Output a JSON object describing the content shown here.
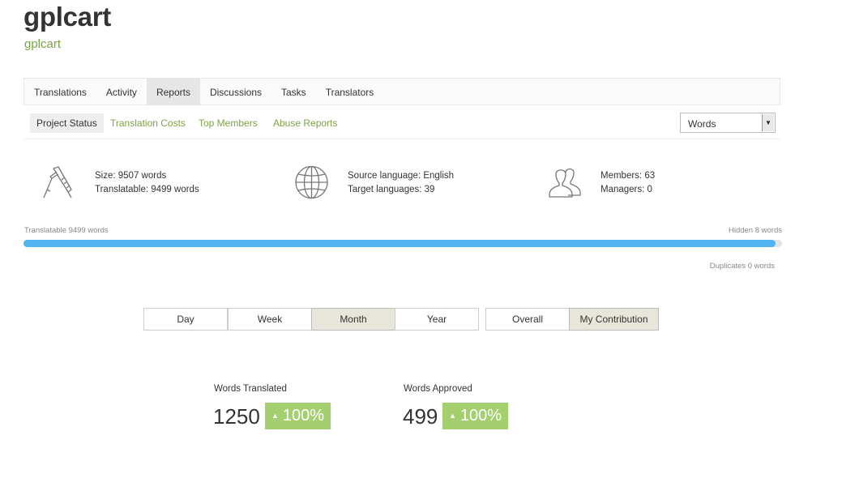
{
  "project": {
    "title": "gplcart",
    "subtitle": "gplcart"
  },
  "tabs": [
    {
      "label": "Translations",
      "active": false
    },
    {
      "label": "Activity",
      "active": false
    },
    {
      "label": "Reports",
      "active": true
    },
    {
      "label": "Discussions",
      "active": false
    },
    {
      "label": "Tasks",
      "active": false
    },
    {
      "label": "Translators",
      "active": false
    }
  ],
  "subtabs": [
    {
      "label": "Project Status",
      "active": true
    },
    {
      "label": "Translation Costs",
      "active": false
    },
    {
      "label": "Top Members",
      "active": false
    },
    {
      "label": "Abuse Reports",
      "active": false
    }
  ],
  "unit_select": {
    "value": "Words"
  },
  "stats": {
    "size": {
      "icon": "caliper-icon",
      "line1": "Size: 9507 words",
      "line2": "Translatable: 9499 words"
    },
    "languages": {
      "icon": "globe-icon",
      "line1": "Source language: English",
      "line2": "Target languages: 39"
    },
    "people": {
      "icon": "members-icon",
      "line1": "Members: 63",
      "line2": "Managers: 0"
    }
  },
  "progress": {
    "left_label": "Translatable 9499 words",
    "right_label": "Hidden 8 words",
    "duplicates_label": "Duplicates 0 words",
    "fraction": 0.9916,
    "color": "#4fb4f0"
  },
  "period_buttons": [
    {
      "label": "Day",
      "active": false
    },
    {
      "label": "Week",
      "active": false
    },
    {
      "label": "Month",
      "active": true
    },
    {
      "label": "Year",
      "active": false
    }
  ],
  "scope_buttons": [
    {
      "label": "Overall",
      "active": false
    },
    {
      "label": "My Contribution",
      "active": true
    }
  ],
  "metrics": [
    {
      "label": "Words Translated",
      "value": "1250",
      "change": "100%"
    },
    {
      "label": "Words Approved",
      "value": "499",
      "change": "100%"
    }
  ],
  "colors": {
    "accent_green": "#7aa443",
    "badge_green": "#a3cf6e"
  }
}
